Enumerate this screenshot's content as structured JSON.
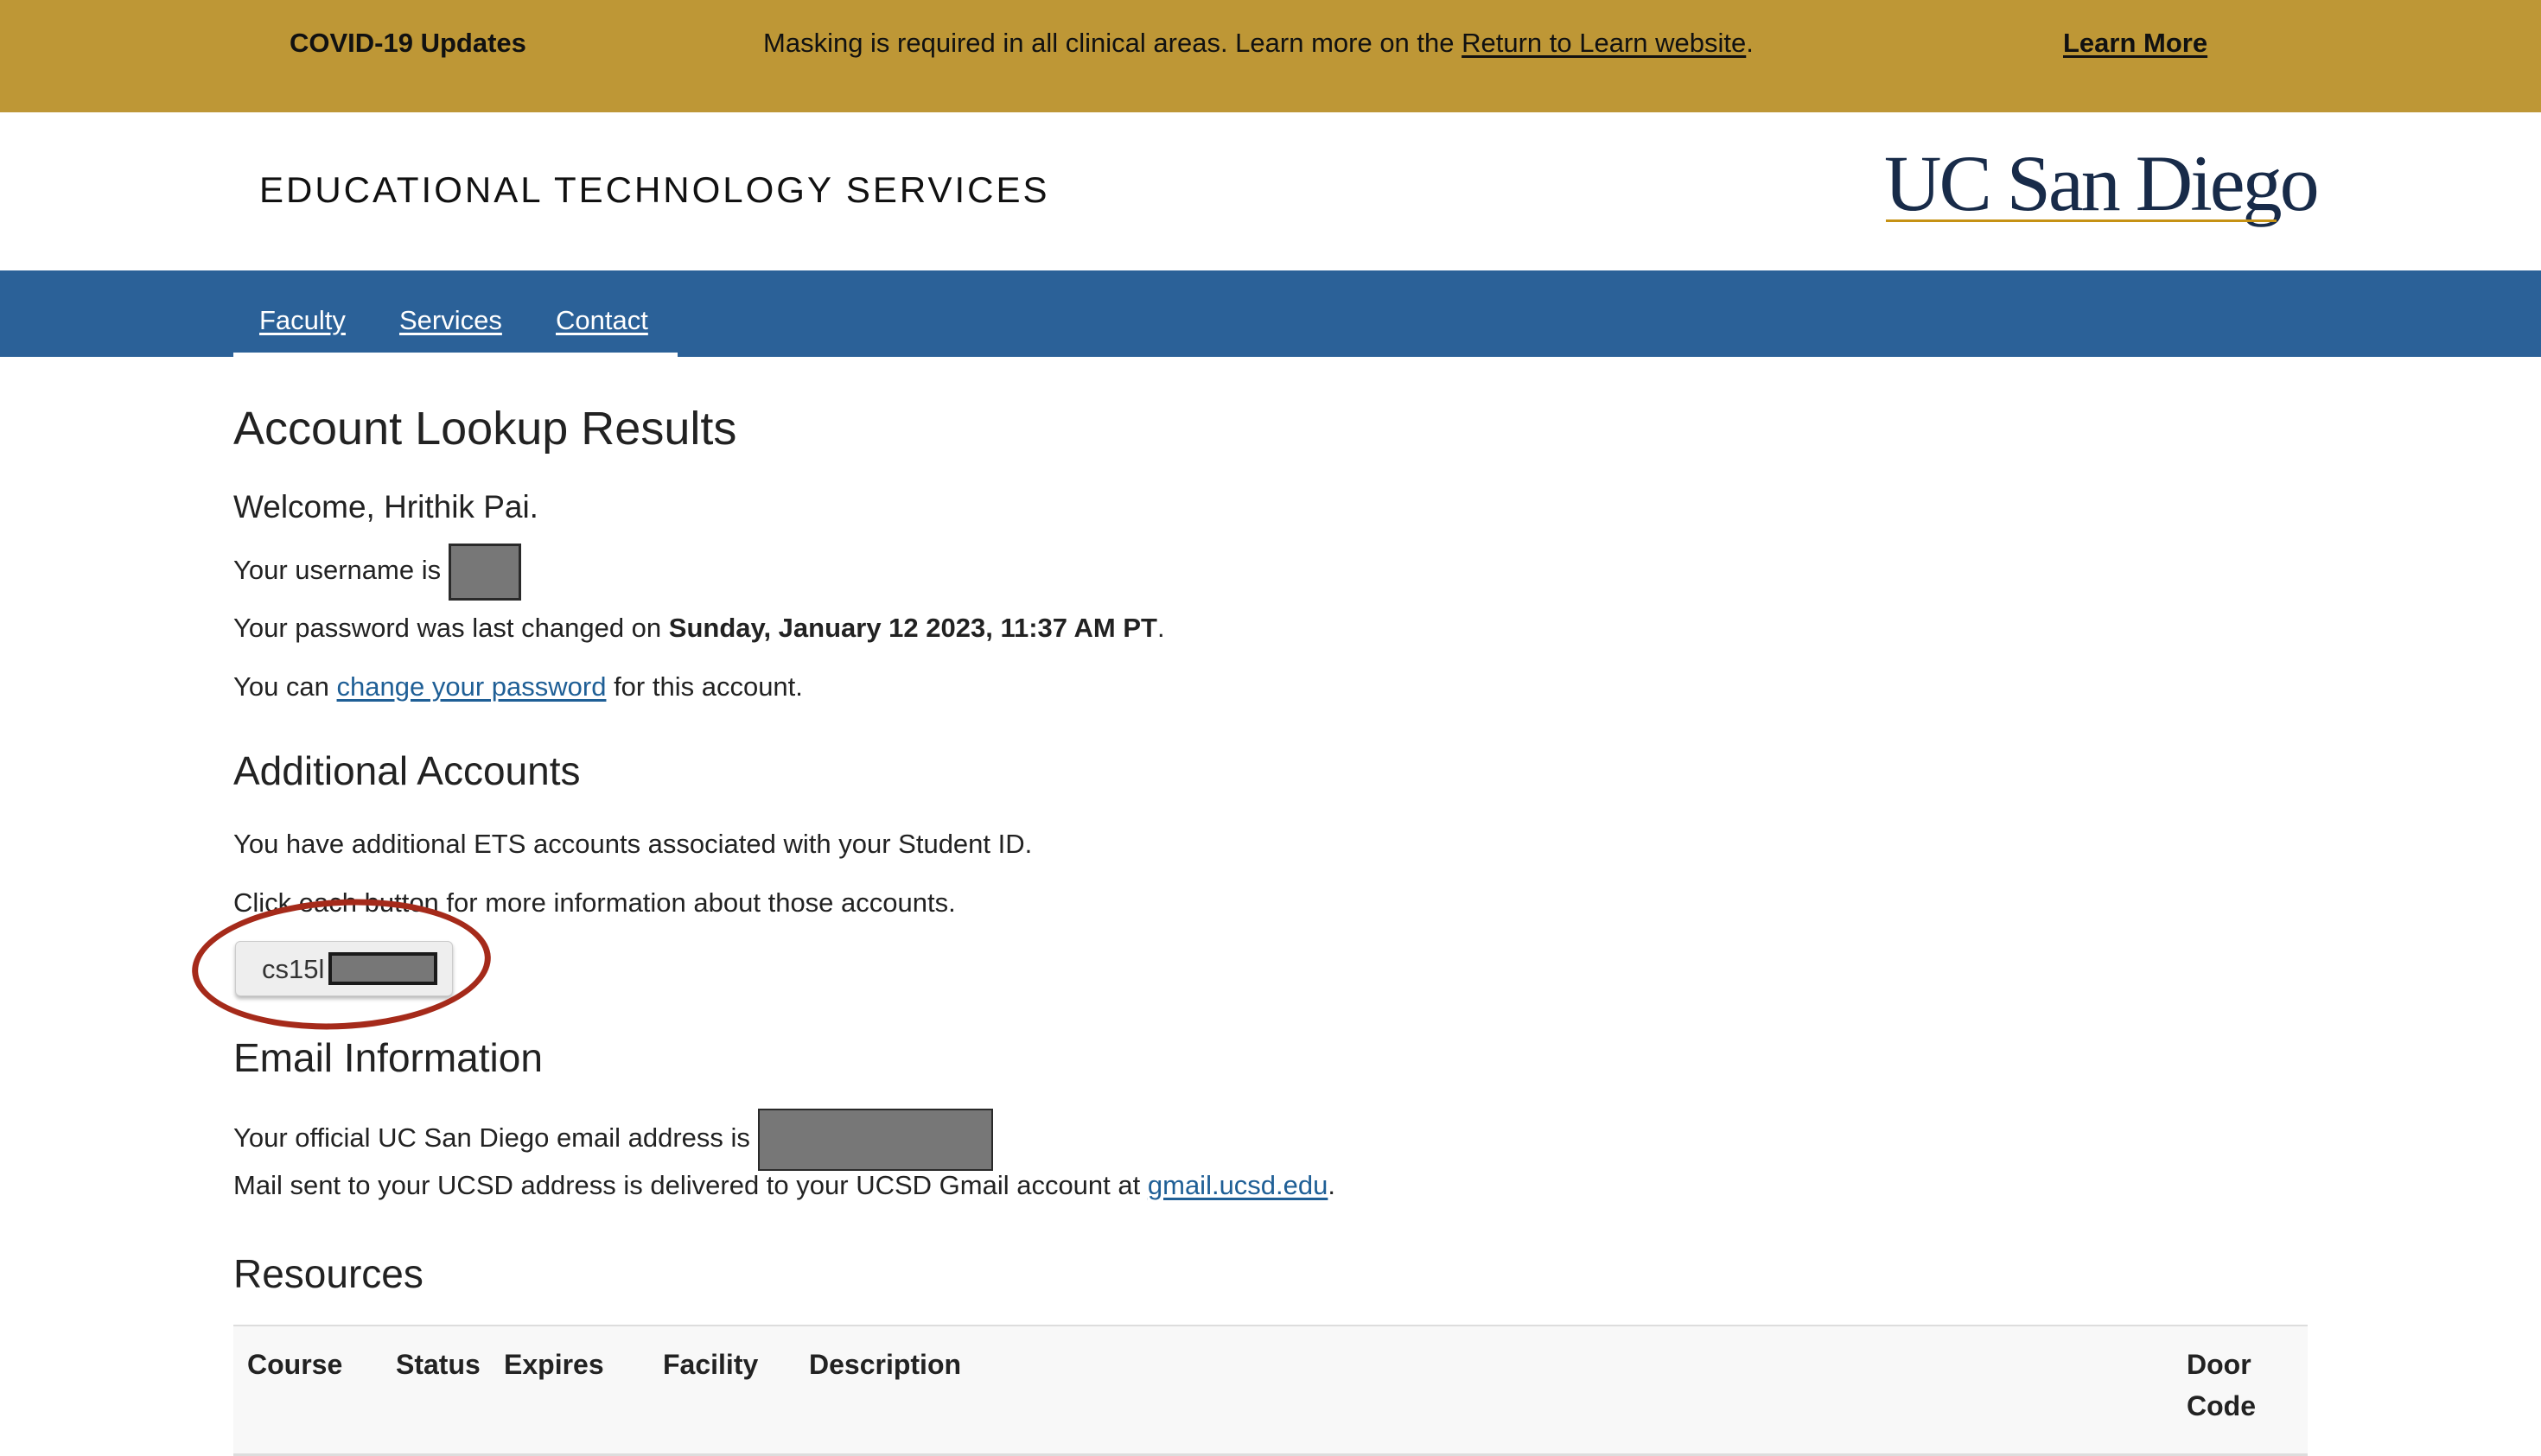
{
  "banner": {
    "title": "COVID-19 Updates",
    "message_prefix": "Masking is required in all clinical areas. Learn more on the ",
    "message_link": "Return to Learn website",
    "message_suffix": ".",
    "learn_more": "Learn More",
    "background_color": "#be9736"
  },
  "header": {
    "site_title": "EDUCATIONAL TECHNOLOGY SERVICES",
    "logo_text": "UC San Diego"
  },
  "nav": {
    "items": [
      {
        "label": "Faculty"
      },
      {
        "label": "Services"
      },
      {
        "label": "Contact"
      }
    ],
    "background_color": "#2b6198"
  },
  "main": {
    "title": "Account Lookup Results",
    "welcome": "Welcome, Hrithik Pai.",
    "username_prefix": "Your username is ",
    "password_prefix": "Your password was last changed on ",
    "password_date": "Sunday, January 12 2023, 11:37 AM PT",
    "password_suffix": ".",
    "change_prefix": "You can ",
    "change_link": "change your password",
    "change_suffix": " for this account."
  },
  "additional": {
    "title": "Additional Accounts",
    "text1": "You have additional ETS accounts associated with your Student ID.",
    "text2": "Click each button for more information about those accounts.",
    "account_button_label": "cs15l"
  },
  "email": {
    "title": "Email Information",
    "address_prefix": "Your official UC San Diego email address is ",
    "mail_prefix": "Mail sent to your UCSD address is delivered to your UCSD Gmail account at ",
    "mail_link": "gmail.ucsd.edu",
    "mail_suffix": "."
  },
  "resources": {
    "title": "Resources",
    "columns": [
      "Course",
      "Status",
      "Expires",
      "Facility",
      "Description",
      "Door Code"
    ]
  },
  "annotation_color": "#a52a1a"
}
